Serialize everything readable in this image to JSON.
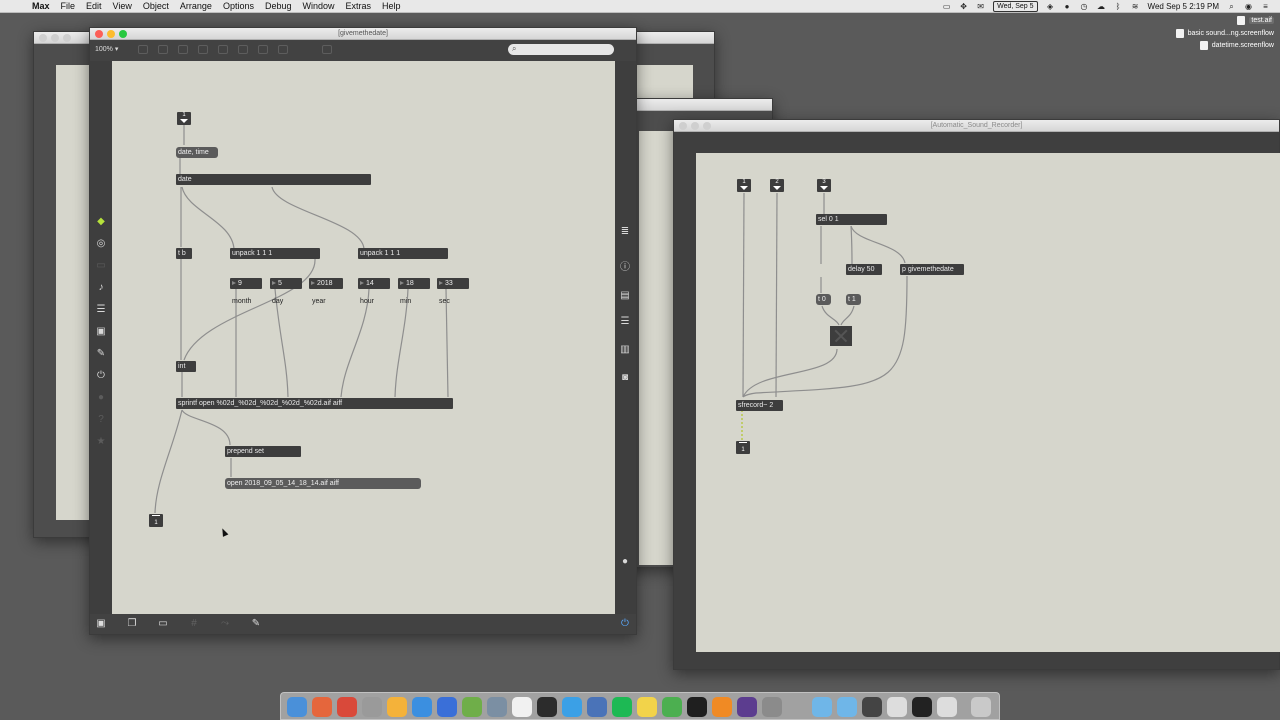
{
  "menubar": {
    "app": "Max",
    "items": [
      "File",
      "Edit",
      "View",
      "Object",
      "Arrange",
      "Options",
      "Debug",
      "Window",
      "Extras",
      "Help"
    ],
    "date_badge": "Wed, Sep 5",
    "clock": "Wed Sep 5  2:19 PM"
  },
  "desktop_files": [
    {
      "name": "test.aif",
      "selected": true
    },
    {
      "name": "basic sound...ng.screenflow",
      "selected": false
    },
    {
      "name": "datetime.screenflow",
      "selected": false
    }
  ],
  "main_window": {
    "title": "[givemethedate]",
    "zoom": "100%",
    "objects": {
      "inlet_num": "1",
      "date_time_msg": "date, time",
      "date_obj": "date",
      "tb_obj": "t b",
      "unpack1": "unpack 1 1 1",
      "unpack2": "unpack 1 1 1",
      "int_obj": "int",
      "sprintf_obj": "sprintf open %02d_%02d_%02d_%02d_%02d.aif aiff",
      "prepend_obj": "prepend set",
      "result_msg": "open 2018_09_05_14_18_14.aif aiff",
      "outlet_num": "1"
    },
    "numbers": [
      {
        "value": "9",
        "label": "month"
      },
      {
        "value": "5",
        "label": "day"
      },
      {
        "value": "2018",
        "label": "year"
      },
      {
        "value": "14",
        "label": "hour"
      },
      {
        "value": "18",
        "label": "min"
      },
      {
        "value": "33",
        "label": "sec"
      }
    ]
  },
  "recorder_window": {
    "title": "[Automatic_Sound_Recorder]",
    "objects": {
      "in1": "1",
      "in2": "2",
      "in3": "3",
      "sel_obj": "sel 0 1",
      "delay_obj": "delay 50",
      "p_obj": "p givemethedate",
      "t0": "t 0",
      "t1": "t 1",
      "sfrecord": "sfrecord~ 2",
      "out1": "1"
    }
  },
  "colors": {
    "canvas": "#d6d6cc",
    "object": "#3d3d3d",
    "message": "#5b5b5b",
    "accent_blue": "#5aa9ff",
    "cube_green": "#b6e23b"
  }
}
